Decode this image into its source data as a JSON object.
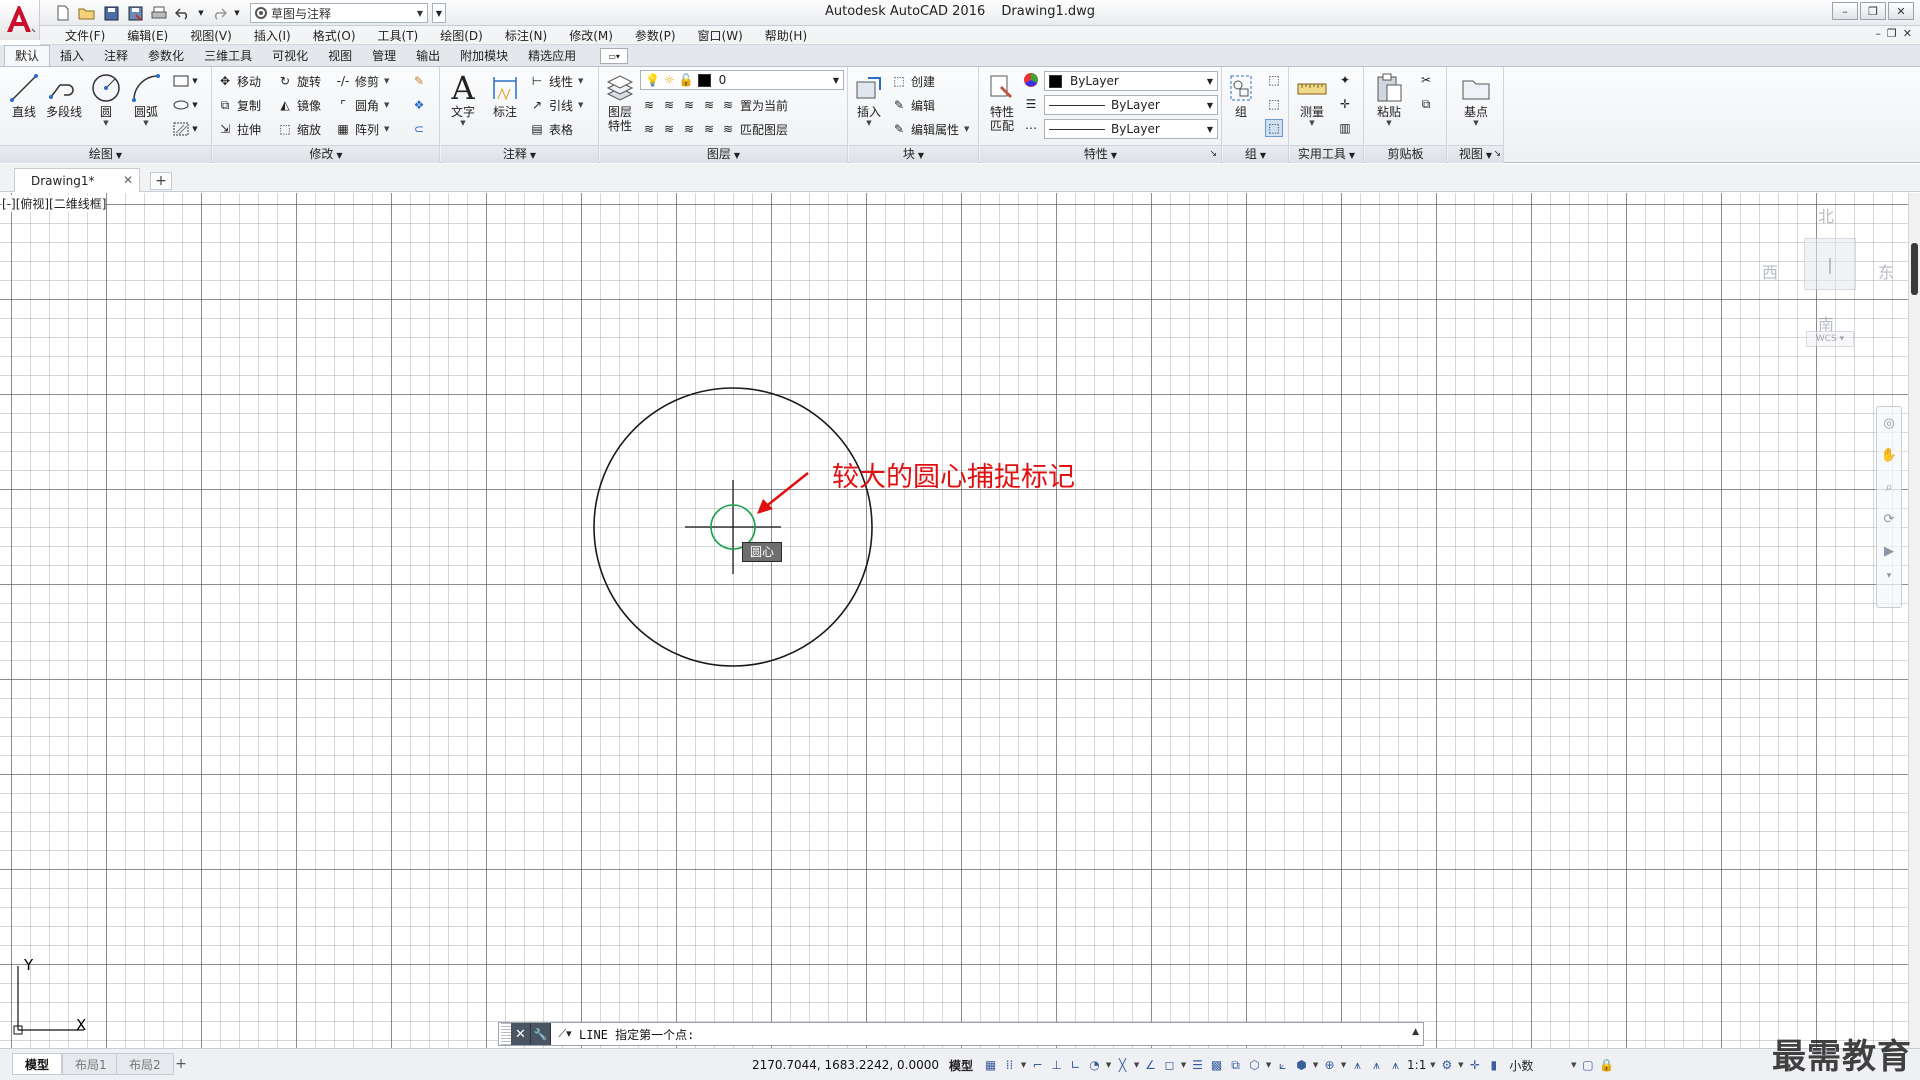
{
  "window": {
    "app_title": "Autodesk AutoCAD 2016",
    "file_name": "Drawing1.dwg",
    "workspace": "草图与注释"
  },
  "menu": [
    "文件(F)",
    "编辑(E)",
    "视图(V)",
    "插入(I)",
    "格式(O)",
    "工具(T)",
    "绘图(D)",
    "标注(N)",
    "修改(M)",
    "参数(P)",
    "窗口(W)",
    "帮助(H)"
  ],
  "ribbon_tabs": [
    "默认",
    "插入",
    "注释",
    "参数化",
    "三维工具",
    "可视化",
    "视图",
    "管理",
    "输出",
    "附加模块",
    "精选应用"
  ],
  "ribbon": {
    "draw": {
      "title": "绘图",
      "line": "直线",
      "polyline": "多段线",
      "circle": "圆",
      "arc": "圆弧"
    },
    "modify": {
      "title": "修改",
      "move": "移动",
      "rotate": "旋转",
      "trim": "修剪",
      "copy": "复制",
      "mirror": "镜像",
      "fillet": "圆角",
      "stretch": "拉伸",
      "scale": "缩放",
      "array": "阵列"
    },
    "annotation": {
      "title": "注释",
      "text": "文字",
      "dimension": "标注",
      "linear": "线性",
      "leader": "引线",
      "table": "表格"
    },
    "layers": {
      "title": "图层",
      "layer_props_1": "图层",
      "layer_props_2": "特性",
      "current_layer": "0",
      "make_current": "置为当前",
      "match_layer": "匹配图层"
    },
    "block": {
      "title": "块",
      "insert": "插入",
      "create": "创建",
      "edit": "编辑",
      "edit_attr": "编辑属性"
    },
    "properties": {
      "title": "特性",
      "match_1": "特性",
      "match_2": "匹配",
      "color": "ByLayer",
      "linetype": "ByLayer",
      "lineweight": "ByLayer"
    },
    "groups": {
      "title": "组",
      "group": "组"
    },
    "utilities": {
      "title": "实用工具",
      "measure": "测量"
    },
    "clipboard": {
      "title": "剪贴板",
      "paste": "粘贴"
    },
    "view": {
      "title": "视图",
      "base": "基点"
    }
  },
  "doc_tab": {
    "name": "Drawing1*"
  },
  "viewport": {
    "label": "[-][俯视][二维线框]"
  },
  "annotation_text": "较大的圆心捕捉标记",
  "snap_tooltip": "圆心",
  "viewcube": {
    "north": "北",
    "south": "南",
    "west": "西",
    "east": "东",
    "wcs": "WCS"
  },
  "ucs": {
    "x": "X",
    "y": "Y"
  },
  "command_line": {
    "prompt": "LINE 指定第一个点:"
  },
  "layout_tabs": [
    "模型",
    "布局1",
    "布局2"
  ],
  "status": {
    "coords": "2170.7044, 1683.2242, 0.0000",
    "model": "模型",
    "scale": "1:1",
    "units": "小数"
  },
  "watermark": "最需教育",
  "colors": {
    "annotation": "#e01010",
    "snap_marker": "#1aa34a"
  }
}
